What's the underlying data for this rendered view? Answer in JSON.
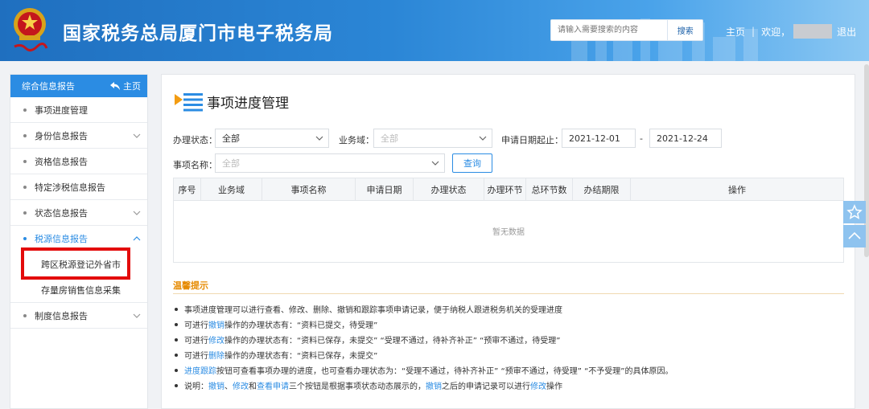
{
  "header": {
    "site_title": "国家税务总局厦门市电子税务局",
    "search_placeholder": "请输入需要搜索的内容",
    "search_button": "搜索",
    "home_link": "主页",
    "welcome": "欢迎，",
    "logout": "退出"
  },
  "sidebar": {
    "title": "综合信息报告",
    "home_label": "主页",
    "items": [
      {
        "label": "事项进度管理"
      },
      {
        "label": "身份信息报告"
      },
      {
        "label": "资格信息报告"
      },
      {
        "label": "特定涉税信息报告"
      },
      {
        "label": "状态信息报告"
      },
      {
        "label": "税源信息报告"
      },
      {
        "label": "制度信息报告"
      }
    ],
    "sub_items": [
      {
        "label": "跨区税源登记外省市"
      },
      {
        "label": "存量房销售信息采集"
      }
    ]
  },
  "main": {
    "page_title": "事项进度管理",
    "filters": {
      "status_label": "办理状态：",
      "status_value": "全部",
      "domain_label": "业务域：",
      "domain_placeholder": "全部",
      "date_label": "申请日期起止：",
      "date_from": "2021-12-01",
      "date_sep": "-",
      "date_to": "2021-12-24",
      "item_label": "事项名称：",
      "item_placeholder": "全部",
      "query_button": "查询"
    },
    "table": {
      "columns": [
        "序号",
        "业务域",
        "事项名称",
        "申请日期",
        "办理状态",
        "办理环节",
        "总环节数",
        "办结期限",
        "操作"
      ],
      "empty_text": "暂无数据"
    },
    "tips": {
      "title": "温馨提示",
      "line1": "事项进度管理可以进行查看、修改、删除、撤销和跟踪事项申请记录，便于纳税人跟进税务机关的受理进度",
      "line2_a": "可进行",
      "line2_link": "撤销",
      "line2_b": "操作的办理状态有：“资料已提交，待受理”",
      "line3_a": "可进行",
      "line3_link": "修改",
      "line3_b": "操作的办理状态有：“资料已保存，未提交”  “受理不通过，待补齐补正”  “预审不通过，待受理”",
      "line4_a": "可进行",
      "line4_link": "删除",
      "line4_b": "操作的办理状态有：“资料已保存，未提交”",
      "line5_link": "进度跟踪",
      "line5_b": "按钮可查看事项办理的进度，也可查看办理状态为：“受理不通过，待补齐补正”  “预审不通过，待受理”  “不予受理”的具体原因。",
      "line6_a": "说明：",
      "line6_l1": "撤销",
      "line6_s1": "、",
      "line6_l2": "修改",
      "line6_s2": "和",
      "line6_l3": "查看申请",
      "line6_s3": "三个按钮是根据事项状态动态展示的，",
      "line6_l4": "撤销",
      "line6_s4": "之后的申请记录可以进行",
      "line6_l5": "修改",
      "line6_s5": "操作"
    }
  },
  "colors": {
    "primary": "#2b8ce3",
    "header_start": "#1f6fbf",
    "tips_title": "#e68a00",
    "highlight_box": "#e30b0b"
  }
}
